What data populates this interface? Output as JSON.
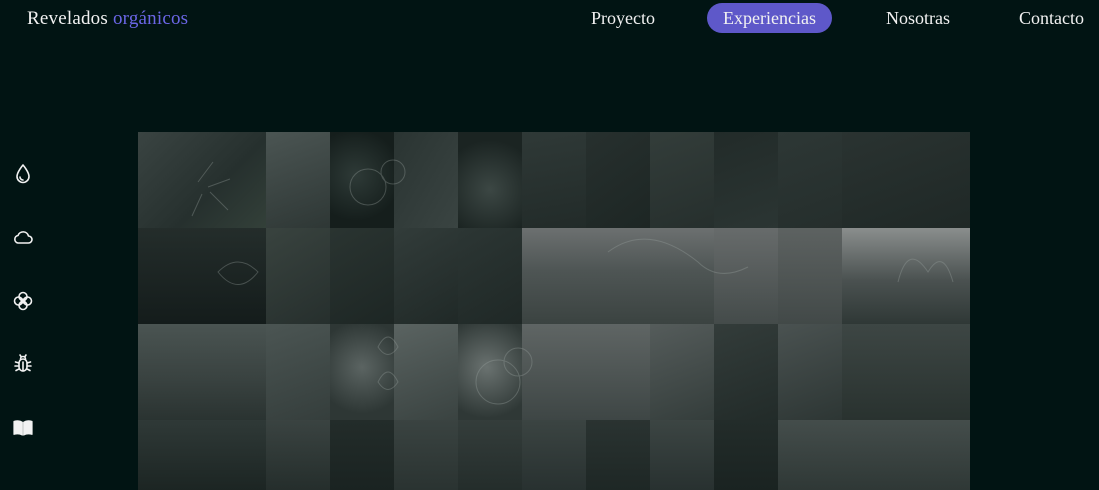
{
  "brand": {
    "part1": "Revelados",
    "part2": "orgánicos"
  },
  "nav": {
    "items": [
      {
        "label": "Proyecto"
      },
      {
        "label": "Experiencias"
      },
      {
        "label": "Nosotras"
      },
      {
        "label": "Contacto"
      }
    ],
    "active_index": 1
  },
  "sidebar": {
    "icons": [
      "water-drop-icon",
      "cloud-icon",
      "flower-icon",
      "bug-icon",
      "book-icon"
    ]
  },
  "colors": {
    "background": "#011413",
    "accent": "#5e58c9",
    "brand_accent": "#6b66e6",
    "text": "#f2f2f2"
  },
  "gallery": {
    "description_note": "photo mosaic of plant and landscape images"
  }
}
